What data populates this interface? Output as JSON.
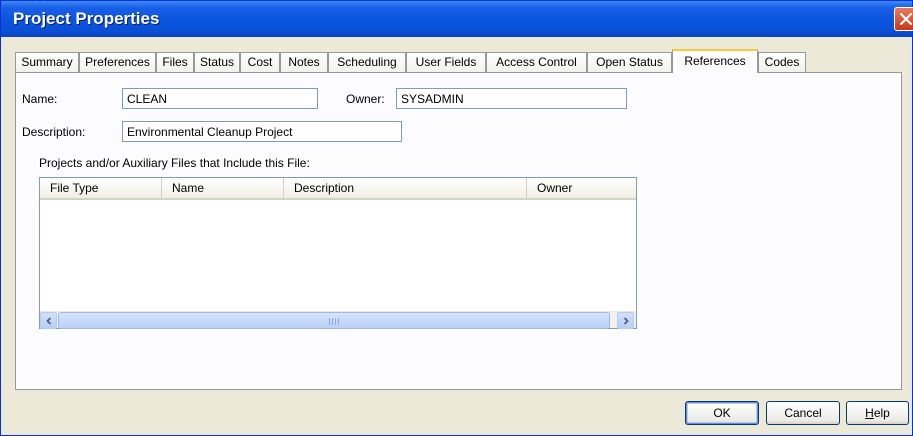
{
  "window": {
    "title": "Project Properties"
  },
  "tabs": [
    {
      "label": "Summary"
    },
    {
      "label": "Preferences"
    },
    {
      "label": "Files"
    },
    {
      "label": "Status"
    },
    {
      "label": "Cost"
    },
    {
      "label": "Notes"
    },
    {
      "label": "Scheduling"
    },
    {
      "label": "User Fields"
    },
    {
      "label": "Access Control"
    },
    {
      "label": "Open Status"
    },
    {
      "label": "References",
      "active": true
    },
    {
      "label": "Codes"
    }
  ],
  "form": {
    "name_label": "Name:",
    "name_value": "CLEAN",
    "owner_label": "Owner:",
    "owner_value": "SYSADMIN",
    "description_label": "Description:",
    "description_value": "Environmental Cleanup Project"
  },
  "references": {
    "section_label": "Projects and/or Auxiliary Files that Include this File:",
    "columns": [
      "File Type",
      "Name",
      "Description",
      "Owner"
    ],
    "rows": []
  },
  "buttons": {
    "ok_label": "OK",
    "cancel_label": "Cancel",
    "help_prefix": "",
    "help_mnemonic": "H",
    "help_rest": "elp"
  },
  "colors": {
    "titlebar": "#0b55e0",
    "active_tab_highlight": "#ffc83c",
    "dialog_background": "#ece9d8"
  }
}
